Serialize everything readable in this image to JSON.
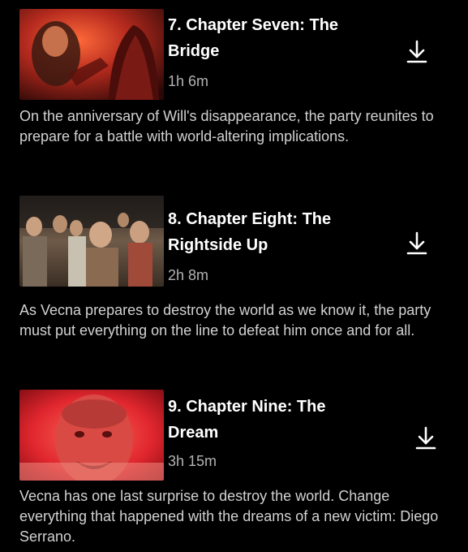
{
  "episodes": [
    {
      "title": "7. Chapter Seven: The Bridge",
      "duration": "1h 6m",
      "description": "On the anniversary of Will's disappearance, the party reunites to prepare for a battle with world-altering implications.",
      "thumbnail_tone": "#b52a1e"
    },
    {
      "title": "8. Chapter Eight: The Rightside Up",
      "duration": "2h 8m",
      "description": "As Vecna prepares to destroy the world as we know it, the party must put everything on the line to defeat him once and for all.",
      "thumbnail_tone": "#6e5a48"
    },
    {
      "title": "9. Chapter Nine: The Dream",
      "duration": "3h 15m",
      "description": "Vecna has one last surprise to destroy the world. Change everything that happened with the dreams of a new victim: Diego Serrano.",
      "thumbnail_tone": "#e0262e"
    }
  ],
  "icons": {
    "download": "download-icon"
  },
  "colors": {
    "background": "#000000",
    "title": "#ffffff",
    "duration": "#b3b3b3",
    "description": "#d2d2d2"
  }
}
